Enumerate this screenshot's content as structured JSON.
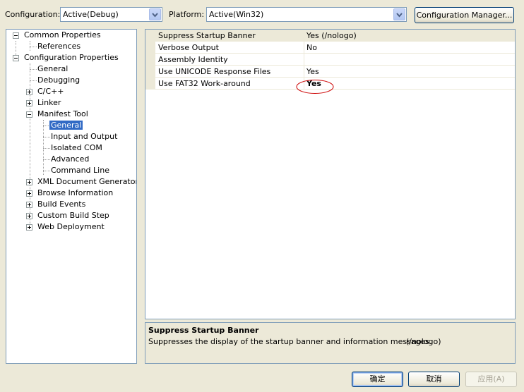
{
  "toolbar": {
    "configuration_label": "Configuration:",
    "configuration_value": "Active(Debug)",
    "platform_label": "Platform:",
    "platform_value": "Active(Win32)",
    "config_manager_button": "Configuration Manager..."
  },
  "tree": {
    "items": [
      {
        "label": "Common Properties"
      },
      {
        "label": "References"
      },
      {
        "label": "Configuration Properties"
      },
      {
        "label": "General"
      },
      {
        "label": "Debugging"
      },
      {
        "label": "C/C++"
      },
      {
        "label": "Linker"
      },
      {
        "label": "Manifest Tool"
      },
      {
        "label": "General",
        "selected": true
      },
      {
        "label": "Input and Output"
      },
      {
        "label": "Isolated COM"
      },
      {
        "label": "Advanced"
      },
      {
        "label": "Command Line"
      },
      {
        "label": "XML Document Generator"
      },
      {
        "label": "Browse Information"
      },
      {
        "label": "Build Events"
      },
      {
        "label": "Custom Build Step"
      },
      {
        "label": "Web Deployment"
      }
    ]
  },
  "grid": {
    "rows": [
      {
        "name": "Suppress Startup Banner",
        "value": "Yes (/nologo)"
      },
      {
        "name": "Verbose Output",
        "value": "No"
      },
      {
        "name": "Assembly Identity",
        "value": ""
      },
      {
        "name": "Use UNICODE Response Files",
        "value": "Yes"
      },
      {
        "name": "Use FAT32 Work-around",
        "value": "Yes"
      }
    ]
  },
  "description": {
    "title": "Suppress Startup Banner",
    "text": "Suppresses the display of the startup banner and information messages.",
    "switch": "(/nologo)"
  },
  "buttons": {
    "ok": "确定",
    "cancel": "取消",
    "apply": "应用(A)"
  },
  "colors": {
    "selection": "#316ac5",
    "highlight_ellipse": "#cc0000",
    "dialog_bg": "#ece9d8"
  }
}
